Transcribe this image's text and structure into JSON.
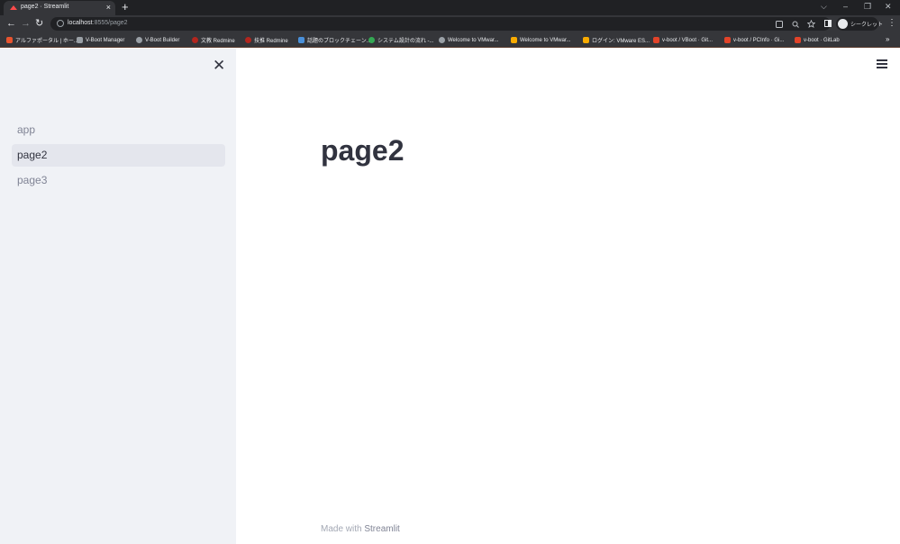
{
  "browser": {
    "tab_title": "page2 · Streamlit",
    "tab_close": "×",
    "new_tab": "+",
    "window_controls": [
      "⌵",
      "–",
      "❐",
      "✕"
    ],
    "url_host": "localhost",
    "url_path": ":8555/page2",
    "nav": {
      "back": "←",
      "forward": "→",
      "reload": "↻"
    },
    "profile_label": "シークレット",
    "menu": "⋮",
    "bookmarks_more": "»",
    "bookmarks": [
      {
        "label": "アルファポータル | ホー...",
        "color": "#e8542f"
      },
      {
        "label": "V-Boot Manager",
        "color": "#9aa0a6"
      },
      {
        "label": "V-Boot Builder",
        "color": "#9aa0a6"
      },
      {
        "label": "文教 Redmine",
        "color": "#b3261e"
      },
      {
        "label": "技推 Redmine",
        "color": "#b3261e"
      },
      {
        "label": "話題のブロックチェーン...",
        "color": "#4a90d9"
      },
      {
        "label": "システム設計の流れ -...",
        "color": "#34a853"
      },
      {
        "label": "Welcome to VMwar...",
        "color": "#9aa0a6"
      },
      {
        "label": "Welcome to VMwar...",
        "color": "#f9ab00"
      },
      {
        "label": "ログイン: VMware ES...",
        "color": "#f9ab00"
      },
      {
        "label": "v-boot / VBoot · Git...",
        "color": "#e24329"
      },
      {
        "label": "v-boot / PCInfo · Gi...",
        "color": "#e24329"
      },
      {
        "label": "v-boot · GitLab",
        "color": "#e24329"
      }
    ]
  },
  "sidebar": {
    "close": "✕",
    "items": [
      {
        "label": "app"
      },
      {
        "label": "page2"
      },
      {
        "label": "page3"
      }
    ]
  },
  "main": {
    "title": "page2",
    "footer_prefix": "Made with ",
    "footer_brand": "Streamlit"
  }
}
